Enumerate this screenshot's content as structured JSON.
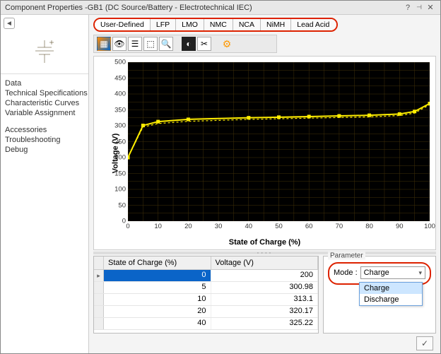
{
  "window": {
    "title": "Component Properties -GB1 (DC Source/Battery - Electrotechnical IEC)",
    "help_icon": "?",
    "pin_icon": "📌",
    "close_icon": "✕"
  },
  "sidebar": {
    "items": [
      {
        "label": "Data"
      },
      {
        "label": "Technical Specifications"
      },
      {
        "label": "Characteristic Curves"
      },
      {
        "label": "Variable Assignment"
      }
    ],
    "items2": [
      {
        "label": "Accessories"
      },
      {
        "label": "Troubleshooting"
      },
      {
        "label": "Debug"
      }
    ]
  },
  "tabs": [
    {
      "label": "User-Defined",
      "active": true
    },
    {
      "label": "LFP"
    },
    {
      "label": "LMO"
    },
    {
      "label": "NMC"
    },
    {
      "label": "NCA"
    },
    {
      "label": "NiMH"
    },
    {
      "label": "Lead Acid"
    }
  ],
  "toolbar": {
    "icons": [
      {
        "name": "img-icon",
        "glyph": "▦"
      },
      {
        "name": "eye-icon",
        "glyph": "👁"
      },
      {
        "name": "list-icon",
        "glyph": "☰"
      },
      {
        "name": "select-icon",
        "glyph": "⬚"
      },
      {
        "name": "zoom-icon",
        "glyph": "🔍"
      },
      {
        "name": "contrast-icon",
        "glyph": "◐"
      },
      {
        "name": "clip-icon",
        "glyph": "✂"
      }
    ],
    "gear": "⚙"
  },
  "chart": {
    "ylabel": "Voltage (V)",
    "xlabel": "State of Charge (%)"
  },
  "chart_data": {
    "type": "line",
    "title": "",
    "xlabel": "State of Charge (%)",
    "ylabel": "Voltage (V)",
    "xlim": [
      0,
      100
    ],
    "ylim": [
      0,
      500
    ],
    "xticks": [
      0,
      10,
      20,
      30,
      40,
      50,
      60,
      70,
      80,
      90,
      100
    ],
    "yticks": [
      0,
      50,
      100,
      150,
      200,
      250,
      300,
      350,
      400,
      450,
      500
    ],
    "series": [
      {
        "name": "Charge",
        "style": "solid",
        "x": [
          0,
          5,
          10,
          20,
          40,
          50,
          60,
          70,
          80,
          90,
          95,
          100
        ],
        "values": [
          200,
          300.98,
          313.1,
          320.17,
          325.22,
          327,
          329,
          331,
          333,
          337,
          345,
          370
        ]
      },
      {
        "name": "Discharge",
        "style": "dashed",
        "x": [
          0,
          5,
          10,
          20,
          40,
          50,
          60,
          70,
          80,
          90,
          95,
          100
        ],
        "values": [
          200,
          296,
          307,
          314,
          320,
          322,
          324,
          326,
          328,
          332,
          340,
          366
        ]
      }
    ]
  },
  "table": {
    "headers": {
      "soc": "State of Charge (%)",
      "v": "Voltage (V)"
    },
    "rows": [
      {
        "soc": "0",
        "v": "200",
        "selected": true,
        "current": true
      },
      {
        "soc": "5",
        "v": "300.98"
      },
      {
        "soc": "10",
        "v": "313.1"
      },
      {
        "soc": "20",
        "v": "320.17"
      },
      {
        "soc": "40",
        "v": "325.22"
      }
    ]
  },
  "param": {
    "title": "Parameter",
    "mode_label": "Mode :",
    "selected": "Charge",
    "options": [
      "Charge",
      "Discharge"
    ]
  },
  "footer": {
    "ok": "✓"
  }
}
